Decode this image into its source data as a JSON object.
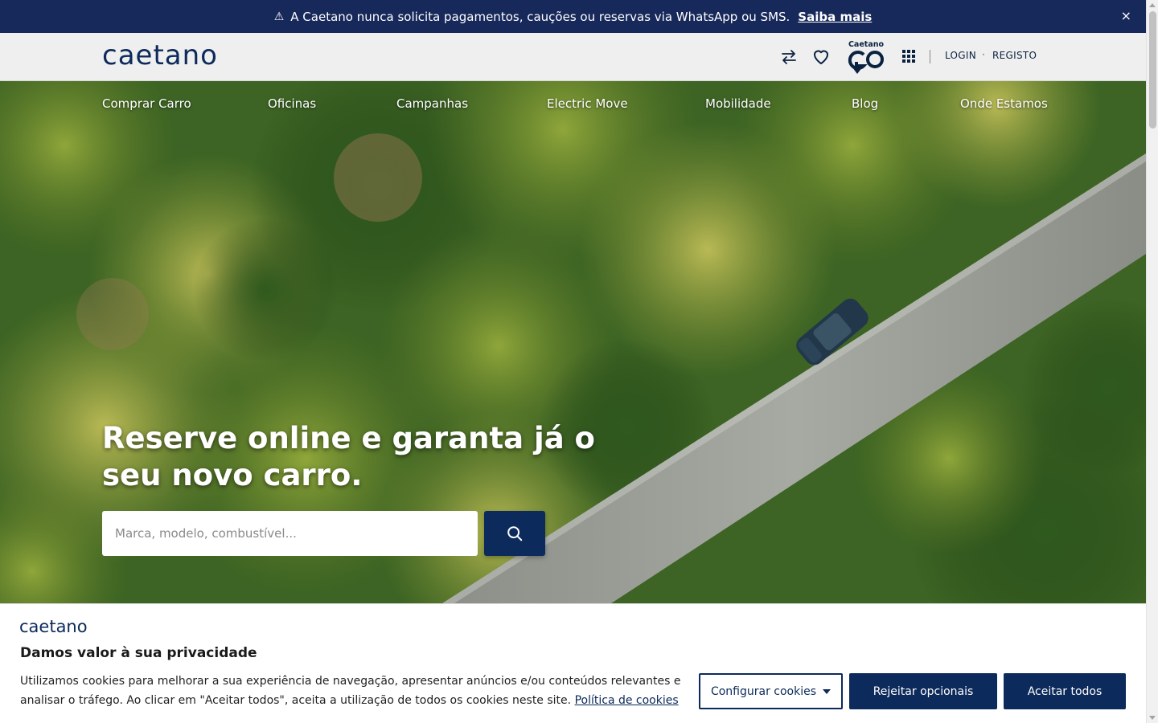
{
  "alert": {
    "icon": "warning-icon",
    "text": "A Caetano nunca solicita pagamentos, cauções ou reservas via WhatsApp ou SMS.",
    "link": "Saiba mais",
    "close": "×"
  },
  "header": {
    "logo": "caetano",
    "icons": [
      "compare-arrows-icon",
      "heart-icon",
      "caetano-go-logo",
      "apps-grid-icon"
    ],
    "go_brand": "Caetano",
    "login": "LOGIN",
    "separator": "·",
    "register": "REGISTO"
  },
  "nav": {
    "items": [
      "Comprar Carro",
      "Oficinas",
      "Campanhas",
      "Electric Move",
      "Mobilidade",
      "Blog",
      "Onde Estamos"
    ]
  },
  "hero": {
    "headline": "Reserve online e garanta já o seu novo carro.",
    "search_placeholder": "Marca, modelo, combustível...",
    "search_icon": "search-icon"
  },
  "cookie": {
    "logo": "caetano",
    "title": "Damos valor à sua privacidade",
    "text": "Utilizamos cookies para melhorar a sua experiência de navegação, apresentar anúncios e/ou conteúdos relevantes e analisar o tráfego. Ao clicar em \"Aceitar todos\", aceita a utilização de todos os cookies neste site.",
    "policy_link": "Política de cookies",
    "configure": "Configurar cookies",
    "reject": "Rejeitar opcionais",
    "accept": "Aceitar todos"
  },
  "colors": {
    "brand_navy": "#0c2a5b",
    "alert_bg": "#17285a",
    "header_bg": "#efefef"
  }
}
